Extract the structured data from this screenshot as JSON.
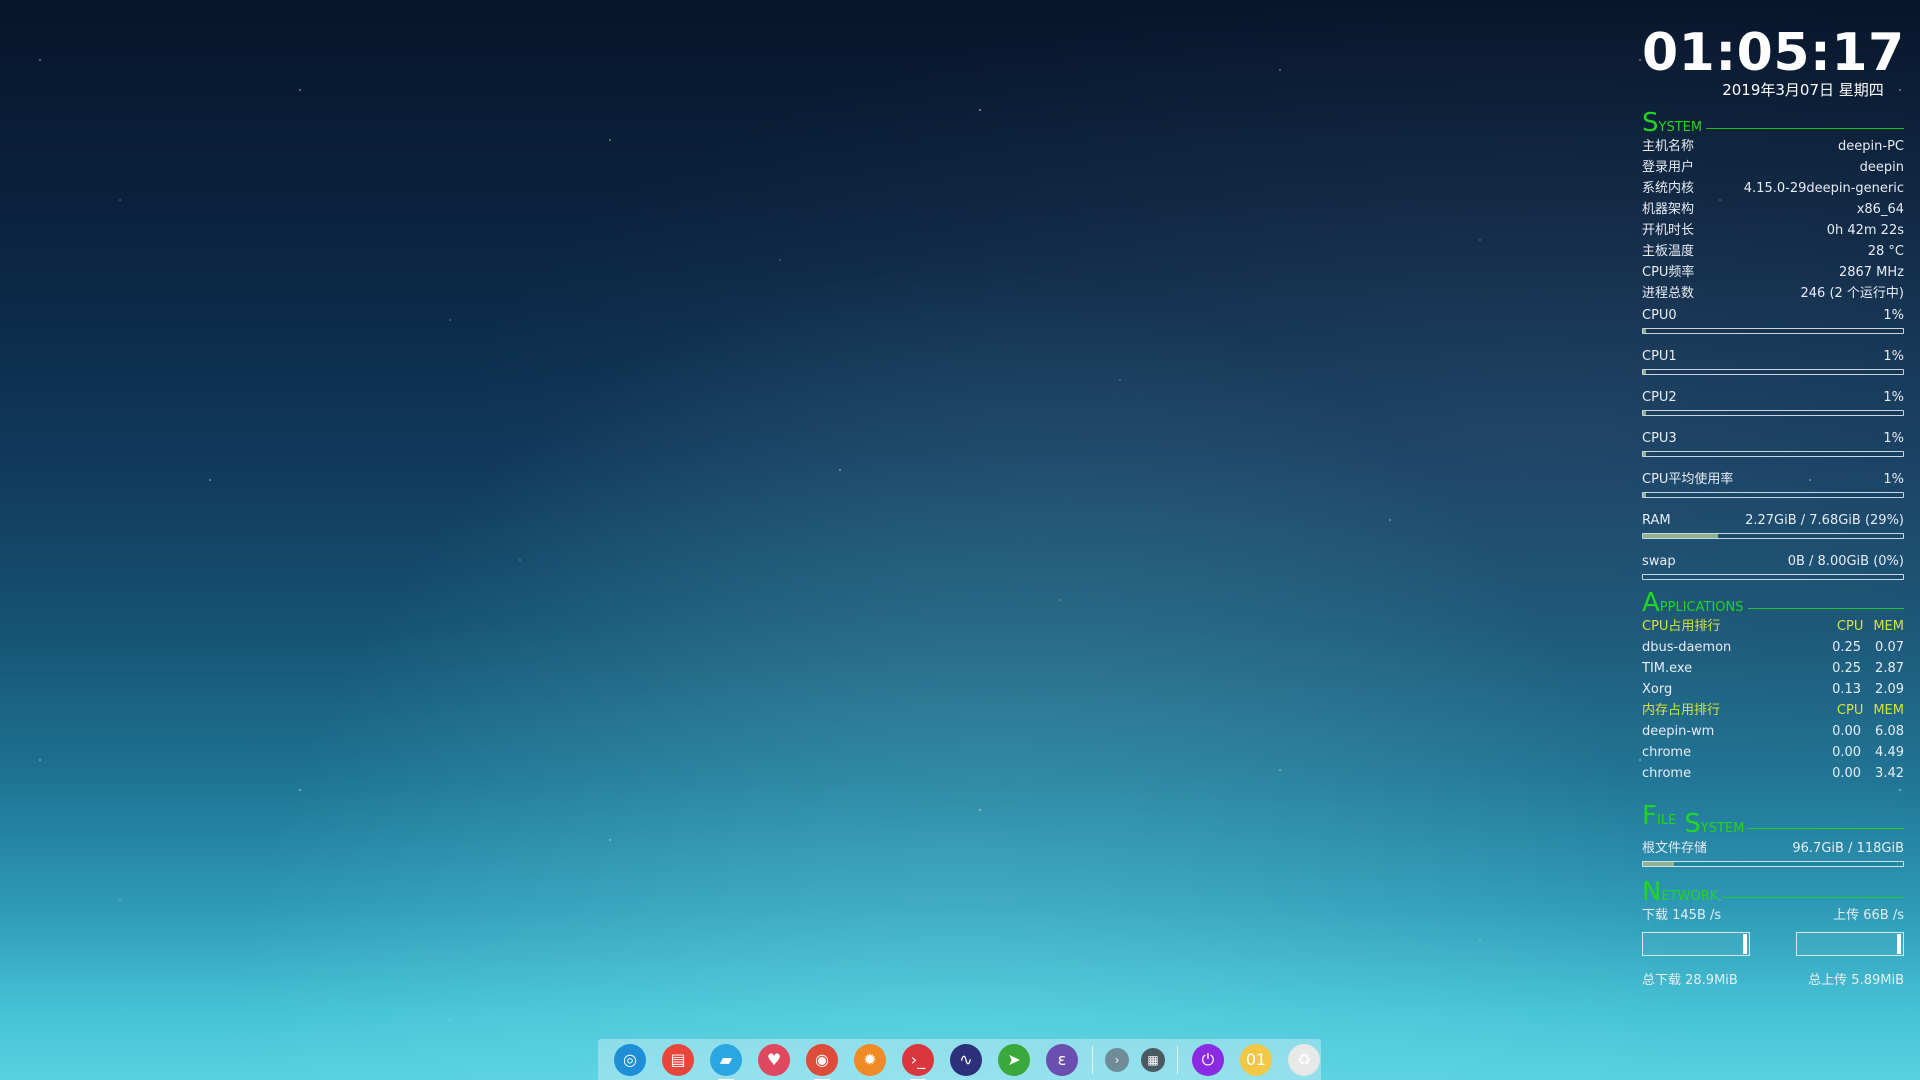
{
  "clock": {
    "time": "01:05:17",
    "date": "2019年3月07日 星期四"
  },
  "system": {
    "title_cap": "S",
    "title_rest": "ystem",
    "rows": [
      {
        "label": "主机名称",
        "value": "deepin-PC"
      },
      {
        "label": "登录用户",
        "value": "deepin"
      },
      {
        "label": "系统内核",
        "value": "4.15.0-29deepin-generic"
      },
      {
        "label": "机器架构",
        "value": "x86_64"
      },
      {
        "label": "开机时长",
        "value": "0h 42m 22s"
      },
      {
        "label": "主板温度",
        "value": "28 °C"
      },
      {
        "label": "CPU频率",
        "value": "2867 MHz"
      },
      {
        "label": "进程总数",
        "value": "246 (2 个运行中)"
      }
    ],
    "meters": [
      {
        "label": "CPU0",
        "value": "1%",
        "fraction": 0.01
      },
      {
        "label": "CPU1",
        "value": "1%",
        "fraction": 0.01
      },
      {
        "label": "CPU2",
        "value": "1%",
        "fraction": 0.01
      },
      {
        "label": "CPU3",
        "value": "1%",
        "fraction": 0.01
      },
      {
        "label": "CPU平均使用率",
        "value": "1%",
        "fraction": 0.01
      },
      {
        "label": "RAM",
        "value": "2.27GiB / 7.68GiB (29%)",
        "fraction": 0.29
      },
      {
        "label": "swap",
        "value": "0B  / 8.00GiB (0%)",
        "fraction": 0.0
      }
    ]
  },
  "applications": {
    "title_cap": "A",
    "title_rest": "pplications",
    "cpu_rank": {
      "heading": "CPU占用排行",
      "col_cpu": "CPU",
      "col_mem": "MEM",
      "rows": [
        {
          "name": "dbus-daemon",
          "cpu": "0.25",
          "mem": "0.07"
        },
        {
          "name": "TIM.exe",
          "cpu": "0.25",
          "mem": "2.87"
        },
        {
          "name": "Xorg",
          "cpu": "0.13",
          "mem": "2.09"
        }
      ]
    },
    "mem_rank": {
      "heading": "内存占用排行",
      "col_cpu": "CPU",
      "col_mem": "MEM",
      "rows": [
        {
          "name": "deepin-wm",
          "cpu": "0.00",
          "mem": "6.08"
        },
        {
          "name": "chrome",
          "cpu": "0.00",
          "mem": "4.49"
        },
        {
          "name": "chrome",
          "cpu": "0.00",
          "mem": "3.42"
        }
      ]
    }
  },
  "file_system": {
    "title1_cap": "F",
    "title1_rest": "ile",
    "title2_cap": "S",
    "title2_rest": "ystem",
    "root_label": "根文件存储",
    "root_value": "96.7GiB / 118GiB",
    "root_fraction": 0.12
  },
  "network": {
    "title_cap": "N",
    "title_rest": "etwork",
    "download": "下载 145B  /s",
    "upload": "上传 66B  /s",
    "total_down": "总下载 28.9MiB",
    "total_up": "总上传 5.89MiB"
  },
  "dock": {
    "apps": [
      {
        "name": "launcher-icon",
        "glyph": "◎",
        "color": "#1e8fd6",
        "running": false
      },
      {
        "name": "multitasking-icon",
        "glyph": "▤",
        "color": "#e8463a",
        "running": false
      },
      {
        "name": "file-manager-icon",
        "glyph": "▰",
        "color": "#2aa6e0",
        "running": true
      },
      {
        "name": "store-icon",
        "glyph": "♥",
        "color": "#e04860",
        "running": false
      },
      {
        "name": "chrome-icon",
        "glyph": "◉",
        "color": "#dd4b39",
        "running": true
      },
      {
        "name": "settings-icon",
        "glyph": "✹",
        "color": "#f08a24",
        "running": false
      },
      {
        "name": "terminal-icon",
        "glyph": "›_",
        "color": "#d9363e",
        "running": true
      },
      {
        "name": "system-monitor-icon",
        "glyph": "∿",
        "color": "#2c2f7a",
        "running": false
      },
      {
        "name": "telegram-icon",
        "glyph": "➤",
        "color": "#3aa83a",
        "running": false
      },
      {
        "name": "emacs-icon",
        "glyph": "ε",
        "color": "#6a4fb0",
        "running": false
      }
    ],
    "tray": [
      {
        "name": "tray-expand-icon",
        "glyph": "›",
        "color": "#6f8c98"
      },
      {
        "name": "keyboard-icon",
        "glyph": "▦",
        "color": "#4a5a62"
      }
    ],
    "system": [
      {
        "name": "power-icon",
        "glyph": "⏻",
        "color": "#8a2be2"
      },
      {
        "name": "clock-icon",
        "glyph": "01",
        "color": "#f2c744"
      },
      {
        "name": "trash-icon",
        "glyph": "♻",
        "color": "#e8e8e8"
      }
    ]
  }
}
